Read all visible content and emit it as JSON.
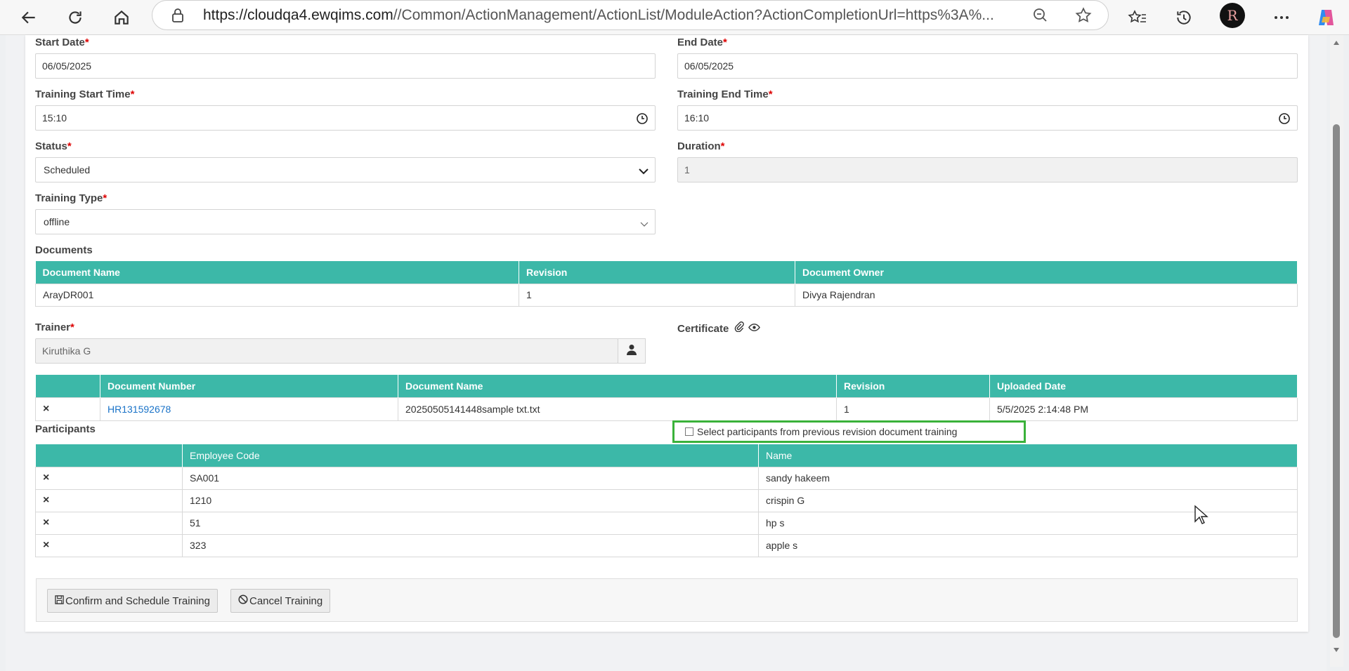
{
  "browser": {
    "url_host": "https://cloudqa4.ewqims.com",
    "url_path": "//Common/ActionManagement/ActionList/ModuleAction?ActionCompletionUrl=https%3A%..."
  },
  "form": {
    "start_date": {
      "label": "Start Date",
      "value": "06/05/2025"
    },
    "end_date": {
      "label": "End Date",
      "value": "06/05/2025"
    },
    "start_time": {
      "label": "Training Start Time",
      "value": "15:10"
    },
    "end_time": {
      "label": "Training End Time",
      "value": "16:10"
    },
    "status": {
      "label": "Status",
      "value": "Scheduled"
    },
    "duration": {
      "label": "Duration",
      "value": "1"
    },
    "training_type": {
      "label": "Training Type",
      "value": "offline"
    },
    "required_mark": "*"
  },
  "documents": {
    "label": "Documents",
    "headers": [
      "Document Name",
      "Revision",
      "Document Owner"
    ],
    "rows": [
      [
        "ArayDR001",
        "1",
        "Divya Rajendran"
      ]
    ]
  },
  "trainer": {
    "label": "Trainer",
    "value": "Kiruthika G"
  },
  "certificate": {
    "label": "Certificate"
  },
  "uploads": {
    "headers": [
      "",
      "Document Number",
      "Document Name",
      "Revision",
      "Uploaded Date"
    ],
    "rows": [
      {
        "remove": "×",
        "number": "HR131592678",
        "name": "20250505141448sample txt.txt",
        "revision": "1",
        "date": "5/5/2025 2:14:48 PM"
      }
    ]
  },
  "participants": {
    "label": "Participants",
    "checkbox_label": "Select participants from previous revision document training",
    "headers": [
      "",
      "Employee Code",
      "Name"
    ],
    "rows": [
      {
        "remove": "×",
        "code": "SA001",
        "name": "sandy hakeem"
      },
      {
        "remove": "×",
        "code": "1210",
        "name": "crispin G"
      },
      {
        "remove": "×",
        "code": "51",
        "name": "hp s"
      },
      {
        "remove": "×",
        "code": "323",
        "name": "apple s"
      }
    ]
  },
  "actions": {
    "confirm_label": "Confirm and Schedule Training",
    "cancel_label": "Cancel Training"
  },
  "colors": {
    "header_teal": "#3cb8a8",
    "link_blue": "#1a73c8",
    "highlight_green": "#3ab23a",
    "required_red": "#dd0000"
  }
}
